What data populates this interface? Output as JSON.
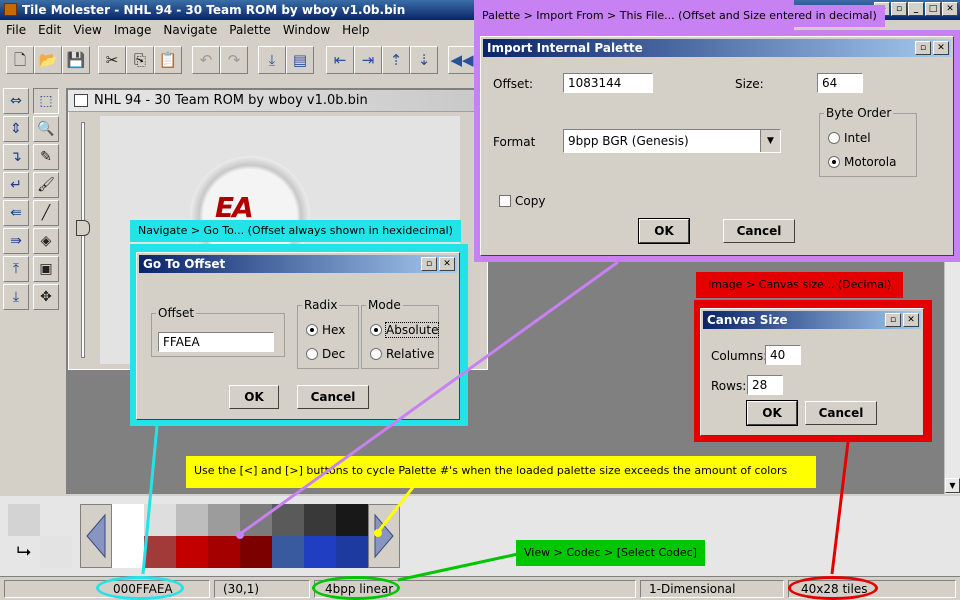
{
  "window": {
    "title": "Tile Molester - NHL 94 - 30 Team ROM by wboy v1.0b.bin"
  },
  "menu": [
    "File",
    "Edit",
    "View",
    "Image",
    "Navigate",
    "Palette",
    "Window",
    "Help"
  ],
  "document": {
    "title": "NHL 94 - 30 Team ROM by wboy v1.0b.bin"
  },
  "callouts": {
    "palette_import": "Palette > Import From > This File... (Offset and Size entered in decimal)",
    "goto": "Navigate > Go To... (Offset always shown in hexidecimal)",
    "canvas": "Image > Canvas size... (Decimal)",
    "palette_cycle": "Use the [<] and [>] buttons to cycle Palette #'s when the loaded palette size exceeds the amount of colors associated to the selected codec.",
    "codec": "View > Codec > [Select Codec]"
  },
  "import_dialog": {
    "title": "Import Internal Palette",
    "offset_label": "Offset:",
    "offset_value": "1083144",
    "size_label": "Size:",
    "size_value": "64",
    "format_label": "Format",
    "format_value": "9bpp BGR (Genesis)",
    "byte_order_label": "Byte Order",
    "intel_label": "Intel",
    "motorola_label": "Motorola",
    "byte_order_selected": "Motorola",
    "copy_label": "Copy",
    "ok_label": "OK",
    "cancel_label": "Cancel"
  },
  "goto_dialog": {
    "title": "Go To Offset",
    "offset_label": "Offset",
    "offset_value": "FFAEA",
    "radix_label": "Radix",
    "hex_label": "Hex",
    "dec_label": "Dec",
    "radix_selected": "Hex",
    "mode_label": "Mode",
    "absolute_label": "Absolute",
    "relative_label": "Relative",
    "mode_selected": "Absolute",
    "ok_label": "OK",
    "cancel_label": "Cancel"
  },
  "canvas_dialog": {
    "title": "Canvas Size",
    "columns_label": "Columns:",
    "columns_value": "40",
    "rows_label": "Rows:",
    "rows_value": "28",
    "ok_label": "OK",
    "cancel_label": "Cancel"
  },
  "palette": {
    "row1": [
      "#ffffff",
      "#dedede",
      "#bdbdbd",
      "#9c9c9c",
      "#7b7b7b",
      "#5a5a5a",
      "#393939",
      "#181818",
      "#000000"
    ],
    "row2": [
      "#ffffff",
      "#a33a3a",
      "#c20000",
      "#a40000",
      "#7c0000",
      "#3a5aa0",
      "#1f3ec2",
      "#1c3a9f",
      "#003a7c"
    ],
    "fg_color": "#d3d3d3",
    "bg_color": "#e3e3e3"
  },
  "status": {
    "offset": "000FFAEA",
    "coords": "(30,1)",
    "codec": "4bpp linear",
    "mode": "1-Dimensional",
    "tiles": "40x28 tiles"
  },
  "colors": {
    "cyan": "#22e3e8",
    "purple": "#c781f2",
    "red": "#e50000",
    "yellow": "#ffff00",
    "green": "#00c600"
  }
}
